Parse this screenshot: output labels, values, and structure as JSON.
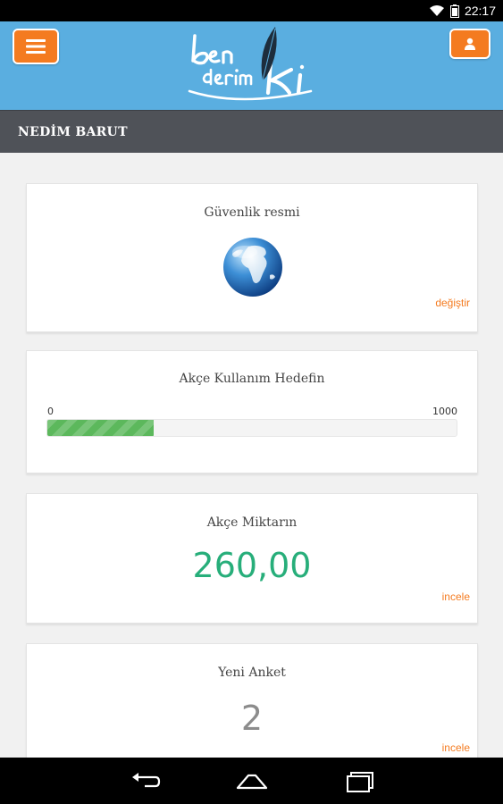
{
  "status_bar": {
    "time": "22:17"
  },
  "header": {
    "logo_text": "ben derim ki"
  },
  "user": {
    "name": "NEDİM BARUT"
  },
  "security_card": {
    "title": "Güvenlik resmi",
    "link": "değiştir"
  },
  "target_card": {
    "title": "Akçe Kullanım Hedefin",
    "min": "0",
    "max": "1000",
    "progress_fraction": 0.26
  },
  "amount_card": {
    "title": "Akçe Miktarın",
    "value": "260,00",
    "link": "incele"
  },
  "survey_card": {
    "title": "Yeni Anket",
    "value": "2",
    "link": "incele"
  },
  "colors": {
    "header": "#5aaee0",
    "accent": "#f47b20",
    "amount": "#27ae7a",
    "user_bar": "#4f5258",
    "progress": "#5cb85c"
  },
  "icons": {
    "menu": "hamburger-icon",
    "profile": "user-icon",
    "security_image": "globe-icon",
    "nav": [
      "back-icon",
      "home-icon",
      "recents-icon"
    ]
  }
}
